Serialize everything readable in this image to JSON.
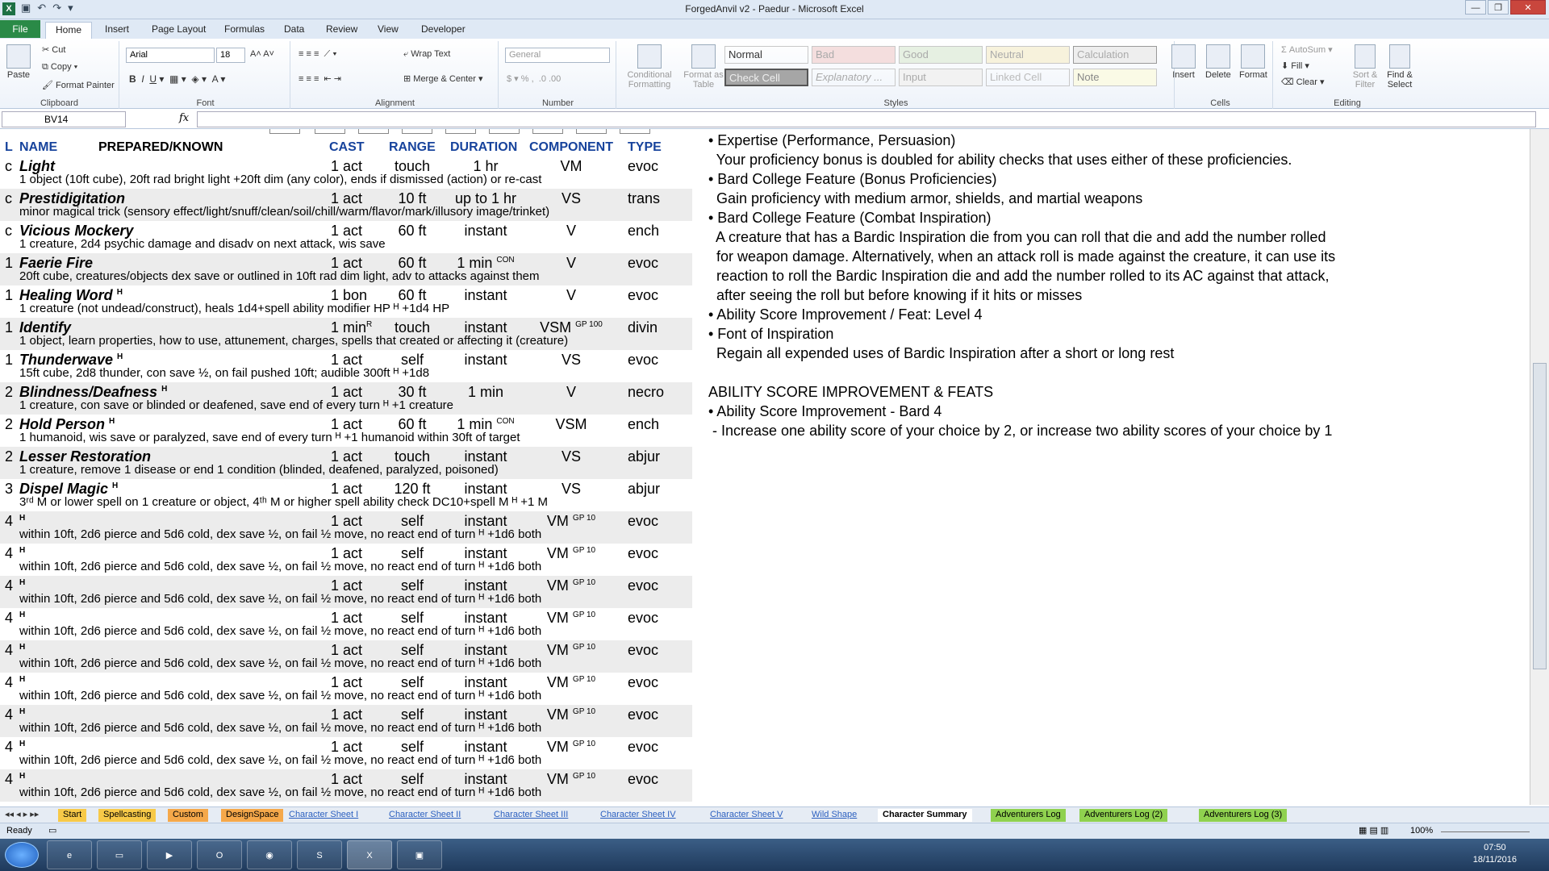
{
  "window": {
    "title": "ForgedAnvil v2 - Paedur - Microsoft Excel"
  },
  "ribbon_tabs": [
    "File",
    "Home",
    "Insert",
    "Page Layout",
    "Formulas",
    "Data",
    "Review",
    "View",
    "Developer"
  ],
  "clipboard": {
    "paste": "Paste",
    "cut": "Cut",
    "copy": "Copy",
    "format_painter": "Format Painter",
    "label": "Clipboard"
  },
  "font": {
    "name": "Arial",
    "size": "18",
    "label": "Font"
  },
  "alignment": {
    "wrap": "Wrap Text",
    "merge": "Merge & Center",
    "label": "Alignment"
  },
  "number": {
    "format": "General",
    "label": "Number"
  },
  "styles": {
    "conditional": "Conditional Formatting",
    "format_table": "Format as Table",
    "cells": [
      "Normal",
      "Bad",
      "Good",
      "Neutral",
      "Calculation",
      "Check Cell",
      "Explanatory ...",
      "Input",
      "Linked Cell",
      "Note"
    ],
    "label": "Styles"
  },
  "cells_group": {
    "insert": "Insert",
    "delete": "Delete",
    "format": "Format",
    "label": "Cells"
  },
  "editing": {
    "autosum": "AutoSum",
    "fill": "Fill",
    "clear": "Clear",
    "sort": "Sort & Filter",
    "find": "Find & Select",
    "label": "Editing"
  },
  "formula": {
    "namebox": "BV14",
    "fx": "fx",
    "value": ""
  },
  "spell_headers": {
    "l": "L",
    "name": "NAME",
    "prepared": "PREPARED/KNOWN",
    "cast": "CAST",
    "range": "RANGE",
    "duration": "DURATION",
    "component": "COMPONENT",
    "type": "TYPE"
  },
  "spells": [
    {
      "lvl": "c",
      "name": "Light",
      "nsup": "",
      "cast": "1 act",
      "csup": "",
      "range": "touch",
      "dur": "1 hr",
      "dsup": "",
      "comp": "VM",
      "gp": "",
      "type": "evoc",
      "desc": "1 object (10ft cube), 20ft rad bright light +20ft dim (any color), ends if dismissed (action) or re-cast"
    },
    {
      "lvl": "c",
      "name": "Prestidigitation",
      "nsup": "",
      "cast": "1 act",
      "csup": "",
      "range": "10 ft",
      "dur": "up to 1 hr",
      "dsup": "",
      "comp": "VS",
      "gp": "",
      "type": "trans",
      "desc": "minor magical trick (sensory effect/light/snuff/clean/soil/chill/warm/flavor/mark/illusory image/trinket)"
    },
    {
      "lvl": "c",
      "name": "Vicious Mockery",
      "nsup": "",
      "cast": "1 act",
      "csup": "",
      "range": "60 ft",
      "dur": "instant",
      "dsup": "",
      "comp": "V",
      "gp": "",
      "type": "ench",
      "desc": "1 creature, 2d4 psychic damage and disadv on next attack, wis save"
    },
    {
      "lvl": "1",
      "name": "Faerie Fire",
      "nsup": "",
      "cast": "1 act",
      "csup": "",
      "range": "60 ft",
      "dur": "1 min",
      "dsup": "CON",
      "comp": "V",
      "gp": "",
      "type": "evoc",
      "desc": "20ft cube, creatures/objects dex save or outlined in 10ft rad dim light, adv to attacks against them"
    },
    {
      "lvl": "1",
      "name": "Healing Word",
      "nsup": "H",
      "cast": "1 bon",
      "csup": "",
      "range": "60 ft",
      "dur": "instant",
      "dsup": "",
      "comp": "V",
      "gp": "",
      "type": "evoc",
      "desc": "1 creature (not undead/construct), heals 1d4+spell ability modifier HP ᴴ +1d4 HP"
    },
    {
      "lvl": "1",
      "name": "Identify",
      "nsup": "",
      "cast": "1 min",
      "csup": "R",
      "range": "touch",
      "dur": "instant",
      "dsup": "",
      "comp": "VSM",
      "gp": "GP 100",
      "type": "divin",
      "desc": "1 object, learn properties, how to use, attunement, charges, spells that created or affecting it (creature)"
    },
    {
      "lvl": "1",
      "name": "Thunderwave",
      "nsup": "H",
      "cast": "1 act",
      "csup": "",
      "range": "self",
      "dur": "instant",
      "dsup": "",
      "comp": "VS",
      "gp": "",
      "type": "evoc",
      "desc": "15ft cube, 2d8 thunder, con save ½, on fail pushed 10ft; audible 300ft ᴴ +1d8"
    },
    {
      "lvl": "2",
      "name": "Blindness/Deafness",
      "nsup": "H",
      "cast": "1 act",
      "csup": "",
      "range": "30 ft",
      "dur": "1 min",
      "dsup": "",
      "comp": "V",
      "gp": "",
      "type": "necro",
      "desc": "1 creature, con save or blinded or deafened, save end of every turn ᴴ +1 creature"
    },
    {
      "lvl": "2",
      "name": "Hold Person",
      "nsup": "H",
      "cast": "1 act",
      "csup": "",
      "range": "60 ft",
      "dur": "1 min",
      "dsup": "CON",
      "comp": "VSM",
      "gp": "",
      "type": "ench",
      "desc": "1 humanoid, wis save or paralyzed, save end of every turn ᴴ +1 humanoid within 30ft of target"
    },
    {
      "lvl": "2",
      "name": "Lesser Restoration",
      "nsup": "",
      "cast": "1 act",
      "csup": "",
      "range": "touch",
      "dur": "instant",
      "dsup": "",
      "comp": "VS",
      "gp": "",
      "type": "abjur",
      "desc": "1 creature, remove 1 disease or end 1 condition (blinded, deafened, paralyzed, poisoned)"
    },
    {
      "lvl": "3",
      "name": "Dispel Magic",
      "nsup": "H",
      "cast": "1 act",
      "csup": "",
      "range": "120 ft",
      "dur": "instant",
      "dsup": "",
      "comp": "VS",
      "gp": "",
      "type": "abjur",
      "desc": "3ʳᵈ M or lower spell on 1 creature or object, 4ᵗʰ M or higher spell ability check DC10+spell M ᴴ +1 M"
    },
    {
      "lvl": "4",
      "name": "",
      "nsup": "H",
      "cast": "1 act",
      "csup": "",
      "range": "self",
      "dur": "instant",
      "dsup": "",
      "comp": "VM",
      "gp": "GP 10",
      "type": "evoc",
      "desc": "within 10ft, 2d6 pierce and 5d6 cold, dex save ½, on fail ½ move, no react end of turn ᴴ +1d6 both"
    },
    {
      "lvl": "4",
      "name": "",
      "nsup": "H",
      "cast": "1 act",
      "csup": "",
      "range": "self",
      "dur": "instant",
      "dsup": "",
      "comp": "VM",
      "gp": "GP 10",
      "type": "evoc",
      "desc": "within 10ft, 2d6 pierce and 5d6 cold, dex save ½, on fail ½ move, no react end of turn ᴴ +1d6 both"
    },
    {
      "lvl": "4",
      "name": "",
      "nsup": "H",
      "cast": "1 act",
      "csup": "",
      "range": "self",
      "dur": "instant",
      "dsup": "",
      "comp": "VM",
      "gp": "GP 10",
      "type": "evoc",
      "desc": "within 10ft, 2d6 pierce and 5d6 cold, dex save ½, on fail ½ move, no react end of turn ᴴ +1d6 both"
    },
    {
      "lvl": "4",
      "name": "",
      "nsup": "H",
      "cast": "1 act",
      "csup": "",
      "range": "self",
      "dur": "instant",
      "dsup": "",
      "comp": "VM",
      "gp": "GP 10",
      "type": "evoc",
      "desc": "within 10ft, 2d6 pierce and 5d6 cold, dex save ½, on fail ½ move, no react end of turn ᴴ +1d6 both"
    },
    {
      "lvl": "4",
      "name": "",
      "nsup": "H",
      "cast": "1 act",
      "csup": "",
      "range": "self",
      "dur": "instant",
      "dsup": "",
      "comp": "VM",
      "gp": "GP 10",
      "type": "evoc",
      "desc": "within 10ft, 2d6 pierce and 5d6 cold, dex save ½, on fail ½ move, no react end of turn ᴴ +1d6 both"
    },
    {
      "lvl": "4",
      "name": "",
      "nsup": "H",
      "cast": "1 act",
      "csup": "",
      "range": "self",
      "dur": "instant",
      "dsup": "",
      "comp": "VM",
      "gp": "GP 10",
      "type": "evoc",
      "desc": "within 10ft, 2d6 pierce and 5d6 cold, dex save ½, on fail ½ move, no react end of turn ᴴ +1d6 both"
    },
    {
      "lvl": "4",
      "name": "",
      "nsup": "H",
      "cast": "1 act",
      "csup": "",
      "range": "self",
      "dur": "instant",
      "dsup": "",
      "comp": "VM",
      "gp": "GP 10",
      "type": "evoc",
      "desc": "within 10ft, 2d6 pierce and 5d6 cold, dex save ½, on fail ½ move, no react end of turn ᴴ +1d6 both"
    },
    {
      "lvl": "4",
      "name": "",
      "nsup": "H",
      "cast": "1 act",
      "csup": "",
      "range": "self",
      "dur": "instant",
      "dsup": "",
      "comp": "VM",
      "gp": "GP 10",
      "type": "evoc",
      "desc": "within 10ft, 2d6 pierce and 5d6 cold, dex save ½, on fail ½ move, no react end of turn ᴴ +1d6 both"
    },
    {
      "lvl": "4",
      "name": "",
      "nsup": "H",
      "cast": "1 act",
      "csup": "",
      "range": "self",
      "dur": "instant",
      "dsup": "",
      "comp": "VM",
      "gp": "GP 10",
      "type": "evoc",
      "desc": "within 10ft, 2d6 pierce and 5d6 cold, dex save ½, on fail ½ move, no react end of turn ᴴ +1d6 both"
    }
  ],
  "features": [
    "• Expertise (Performance, Persuasion)",
    "  Your proficiency bonus is doubled for ability checks that uses either of these proficiencies.",
    "• Bard College Feature (Bonus Proficiencies)",
    "  Gain proficiency with medium armor, shields, and martial weapons",
    "• Bard College Feature (Combat Inspiration)",
    "  A creature that has a Bardic Inspiration die from you can roll that die and add the number rolled",
    "  for weapon damage. Alternatively, when an attack roll is made against the creature, it can use its",
    "  reaction to roll the Bardic Inspiration die and add the number rolled to its AC against that attack,",
    "  after seeing the roll but before knowing if it hits or misses",
    "• Ability Score Improvement / Feat: Level 4",
    "• Font of Inspiration",
    "  Regain all expended uses of Bardic Inspiration after a short or long rest",
    "",
    "ABILITY SCORE IMPROVEMENT & FEATS",
    "• Ability Score Improvement - Bard 4",
    " - Increase one ability score of your choice by 2, or increase two ability scores of your choice by 1"
  ],
  "sheet_tabs": [
    {
      "label": "Start",
      "color": "#f7c948",
      "active": false
    },
    {
      "label": "Spellcasting",
      "color": "#f7c948",
      "active": false
    },
    {
      "label": "Custom",
      "color": "#f5a84a",
      "active": false
    },
    {
      "label": "DesignSpace",
      "color": "#f5a84a",
      "active": false
    },
    {
      "label": "Character Sheet I",
      "color": "",
      "active": false
    },
    {
      "label": "Character Sheet II",
      "color": "",
      "active": false
    },
    {
      "label": "Character Sheet III",
      "color": "",
      "active": false
    },
    {
      "label": "Character Sheet IV",
      "color": "",
      "active": false
    },
    {
      "label": "Character Sheet V",
      "color": "",
      "active": false
    },
    {
      "label": "Wild Shape",
      "color": "",
      "active": false
    },
    {
      "label": "Character Summary",
      "color": "#ffffff",
      "active": true
    },
    {
      "label": "Adventurers Log",
      "color": "#8fd14f",
      "active": false
    },
    {
      "label": "Adventurers Log (2)",
      "color": "#8fd14f",
      "active": false
    },
    {
      "label": "Adventurers Log (3)",
      "color": "#8fd14f",
      "active": false
    }
  ],
  "status": {
    "ready": "Ready",
    "zoom": "100%"
  },
  "clock": {
    "time": "07:50",
    "date": "18/11/2016"
  }
}
